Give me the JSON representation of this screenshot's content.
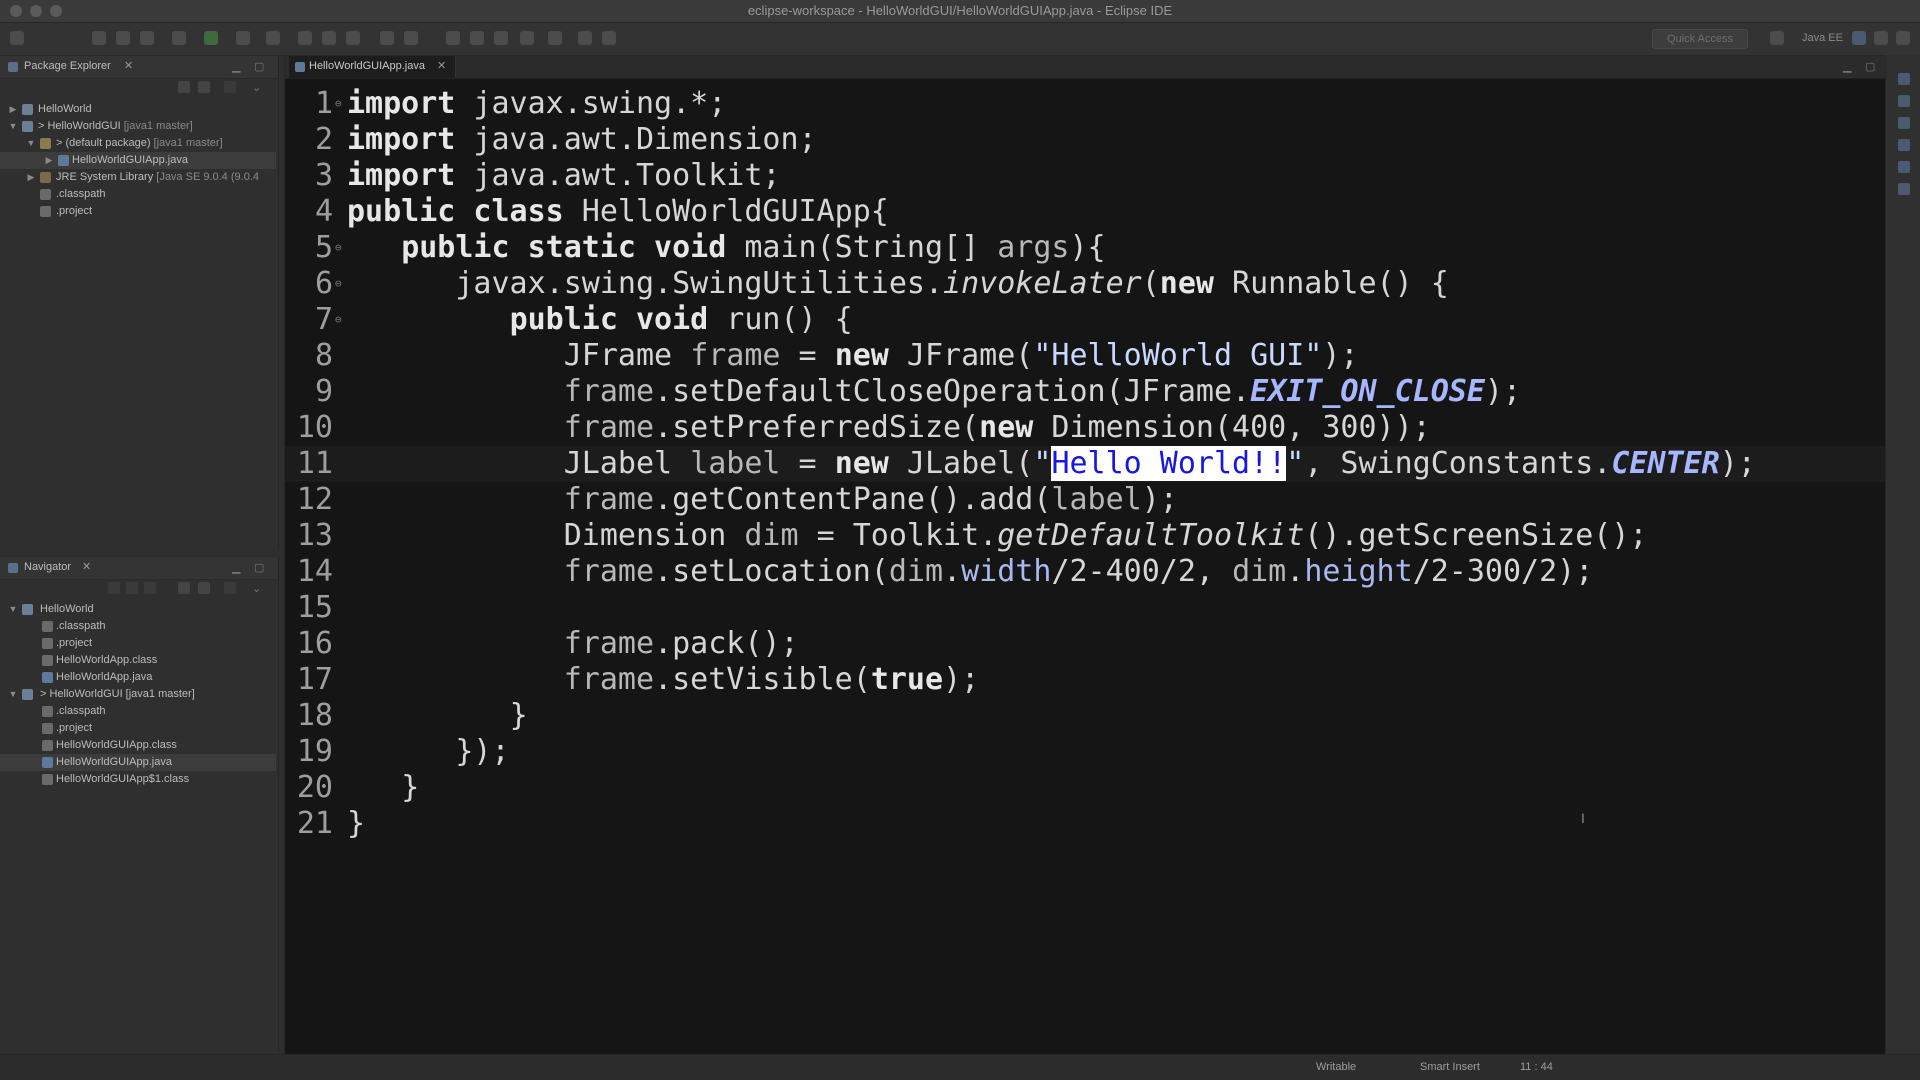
{
  "window": {
    "title": "eclipse-workspace - HelloWorldGUI/HelloWorldGUIApp.java - Eclipse IDE"
  },
  "toolbar": {
    "quick_access_placeholder": "Quick Access",
    "perspective_label": "Java EE"
  },
  "package_explorer": {
    "title": "Package Explorer",
    "items": [
      {
        "label": "HelloWorld",
        "deco": ""
      },
      {
        "label": "> HelloWorldGUI",
        "deco": " [java1 master]"
      },
      {
        "label": "> (default package)",
        "deco": " [java1 master]"
      },
      {
        "label": "HelloWorldGUIApp.java",
        "deco": ""
      },
      {
        "label": "JRE System Library",
        "deco": " [Java SE 9.0.4 (9.0.4"
      },
      {
        "label": ".classpath",
        "deco": ""
      },
      {
        "label": ".project",
        "deco": ""
      }
    ]
  },
  "navigator": {
    "title": "Navigator",
    "items": [
      {
        "label": "HelloWorld"
      },
      {
        "label": ".classpath"
      },
      {
        "label": ".project"
      },
      {
        "label": "HelloWorldApp.class"
      },
      {
        "label": "HelloWorldApp.java"
      },
      {
        "label": "> HelloWorldGUI [java1 master]"
      },
      {
        "label": ".classpath"
      },
      {
        "label": ".project"
      },
      {
        "label": "HelloWorldGUIApp.class"
      },
      {
        "label": "HelloWorldGUIApp.java"
      },
      {
        "label": "HelloWorldGUIApp$1.class"
      }
    ]
  },
  "editor": {
    "tab_label": "HelloWorldGUIApp.java",
    "line_numbers": [
      "1",
      "2",
      "3",
      "4",
      "5",
      "6",
      "7",
      "8",
      "9",
      "10",
      "11",
      "12",
      "13",
      "14",
      "15",
      "16",
      "17",
      "18",
      "19",
      "20",
      "21"
    ],
    "tokens": {
      "l1_kw": "import",
      "l1_rest": " javax.swing.*;",
      "l2_kw": "import",
      "l2_rest": " java.awt.Dimension;",
      "l3_kw": "import",
      "l3_rest": " java.awt.Toolkit;",
      "l4_kw": "public class",
      "l4_rest": " HelloWorldGUIApp{",
      "l5_indent": "   ",
      "l5_kw": "public static void",
      "l5_a": " main(String[] ",
      "l5_args": "args",
      "l5_b": "){",
      "l6_indent": "      ",
      "l6_a": "javax.swing.SwingUtilities.",
      "l6_method": "invokeLater",
      "l6_b": "(",
      "l6_kw": "new",
      "l6_c": " Runnable() {",
      "l7_indent": "         ",
      "l7_kw": "public void",
      "l7_rest": " run() {",
      "l8_indent": "            ",
      "l8_a": "JFrame ",
      "l8_var": "frame",
      "l8_b": " = ",
      "l8_kw": "new",
      "l8_c": " JFrame(",
      "l8_str": "\"HelloWorld GUI\"",
      "l8_d": ");",
      "l9_indent": "            ",
      "l9_var": "frame",
      "l9_a": ".setDefaultCloseOperation(JFrame.",
      "l9_field": "EXIT_ON_CLOSE",
      "l9_b": ");",
      "l10_indent": "            ",
      "l10_var": "frame",
      "l10_a": ".setPreferredSize(",
      "l10_kw": "new",
      "l10_b": " Dimension(400, 300));",
      "l11_indent": "            ",
      "l11_a": "JLabel ",
      "l11_var": "label",
      "l11_b": " = ",
      "l11_kw": "new",
      "l11_c": " JLabel(",
      "l11_q1": "\"",
      "l11_sel": "Hello World!!",
      "l11_q2": "\"",
      "l11_d": ", SwingConstants.",
      "l11_field": "CENTER",
      "l11_e": ");",
      "l12_indent": "            ",
      "l12_var": "frame",
      "l12_a": ".getContentPane().add(",
      "l12_var2": "label",
      "l12_b": ");",
      "l13_indent": "            ",
      "l13_a": "Dimension ",
      "l13_var": "dim",
      "l13_b": " = Toolkit.",
      "l13_method": "getDefaultToolkit",
      "l13_c": "().getScreenSize();",
      "l14_indent": "            ",
      "l14_var": "frame",
      "l14_a": ".setLocation(",
      "l14_var2": "dim",
      "l14_b": ".",
      "l14_mem": "width",
      "l14_c": "/2-400/2, ",
      "l14_var3": "dim",
      "l14_d": ".",
      "l14_mem2": "height",
      "l14_e": "/2-300/2);",
      "l16_indent": "            ",
      "l16_var": "frame",
      "l16_a": ".pack();",
      "l17_indent": "            ",
      "l17_var": "frame",
      "l17_a": ".setVisible(",
      "l17_kw": "true",
      "l17_b": ");",
      "l18_indent": "         ",
      "l18_a": "}",
      "l19_indent": "      ",
      "l19_a": "});",
      "l20_indent": "   ",
      "l20_a": "}",
      "l21_a": "}"
    }
  },
  "status": {
    "writable": "Writable",
    "insert_mode": "Smart Insert",
    "position": "11 : 44"
  }
}
